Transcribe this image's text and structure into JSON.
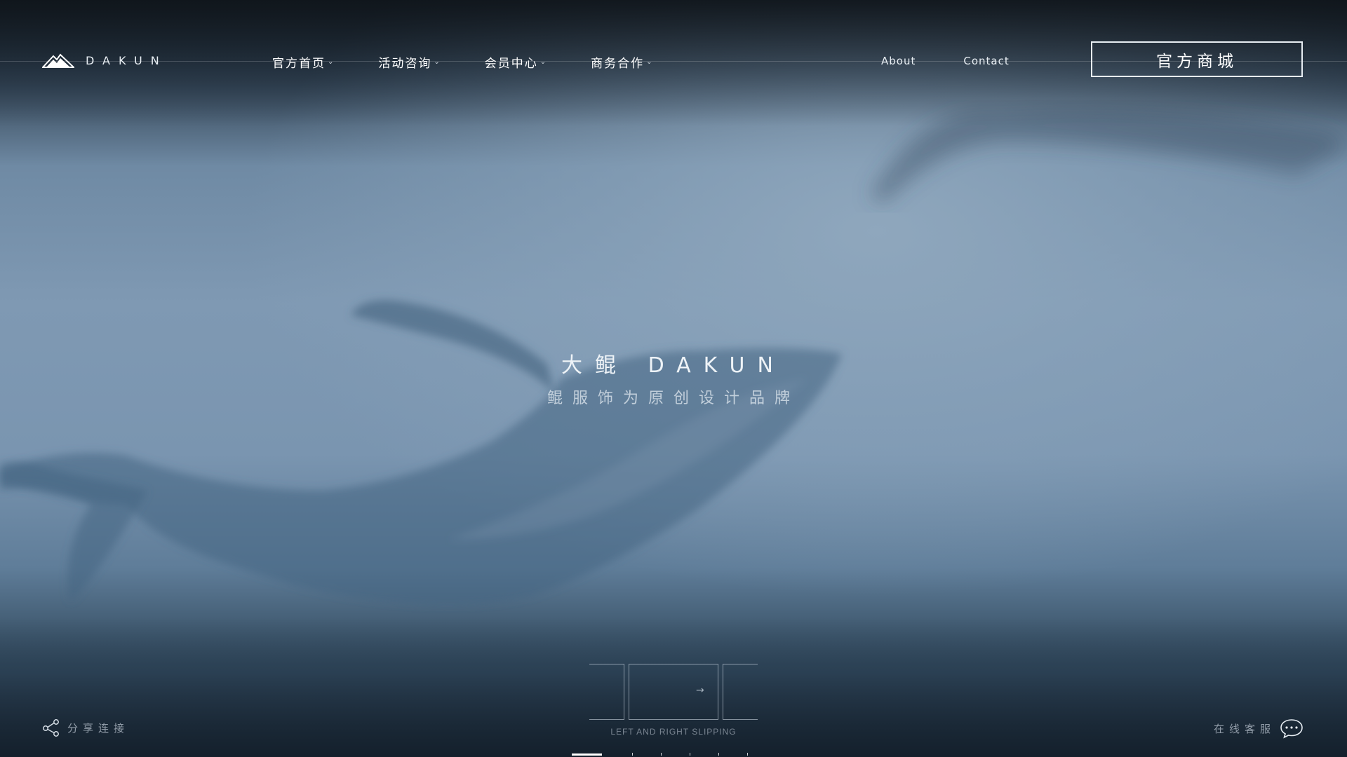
{
  "brand": {
    "name": "DAKUN",
    "logo_icon": "mountain-icon"
  },
  "nav": {
    "items": [
      {
        "label": "官方首页",
        "icon": "chevron-down-icon"
      },
      {
        "label": "活动咨询",
        "icon": "chevron-down-icon"
      },
      {
        "label": "会员中心",
        "icon": "chevron-down-icon"
      },
      {
        "label": "商务合作",
        "icon": "chevron-down-icon"
      }
    ],
    "links": [
      "About",
      "Contact"
    ],
    "shop_button": "官方商城"
  },
  "hero": {
    "title": "大鲲 DAKUN",
    "subtitle": "鲲服饰为原创设计品牌"
  },
  "slider_hint": {
    "label": "LEFT AND RIGHT SLIPPING",
    "icon": "arrow-right-icon"
  },
  "footer": {
    "share_label": "分享连接",
    "share_icon": "share-icon",
    "service_label": "在线客服",
    "service_icon": "chat-bubble-icon"
  },
  "pager": {
    "total": 6,
    "active": 1
  },
  "colors": {
    "accent": "#ffffff",
    "background": "#7f99b3"
  }
}
